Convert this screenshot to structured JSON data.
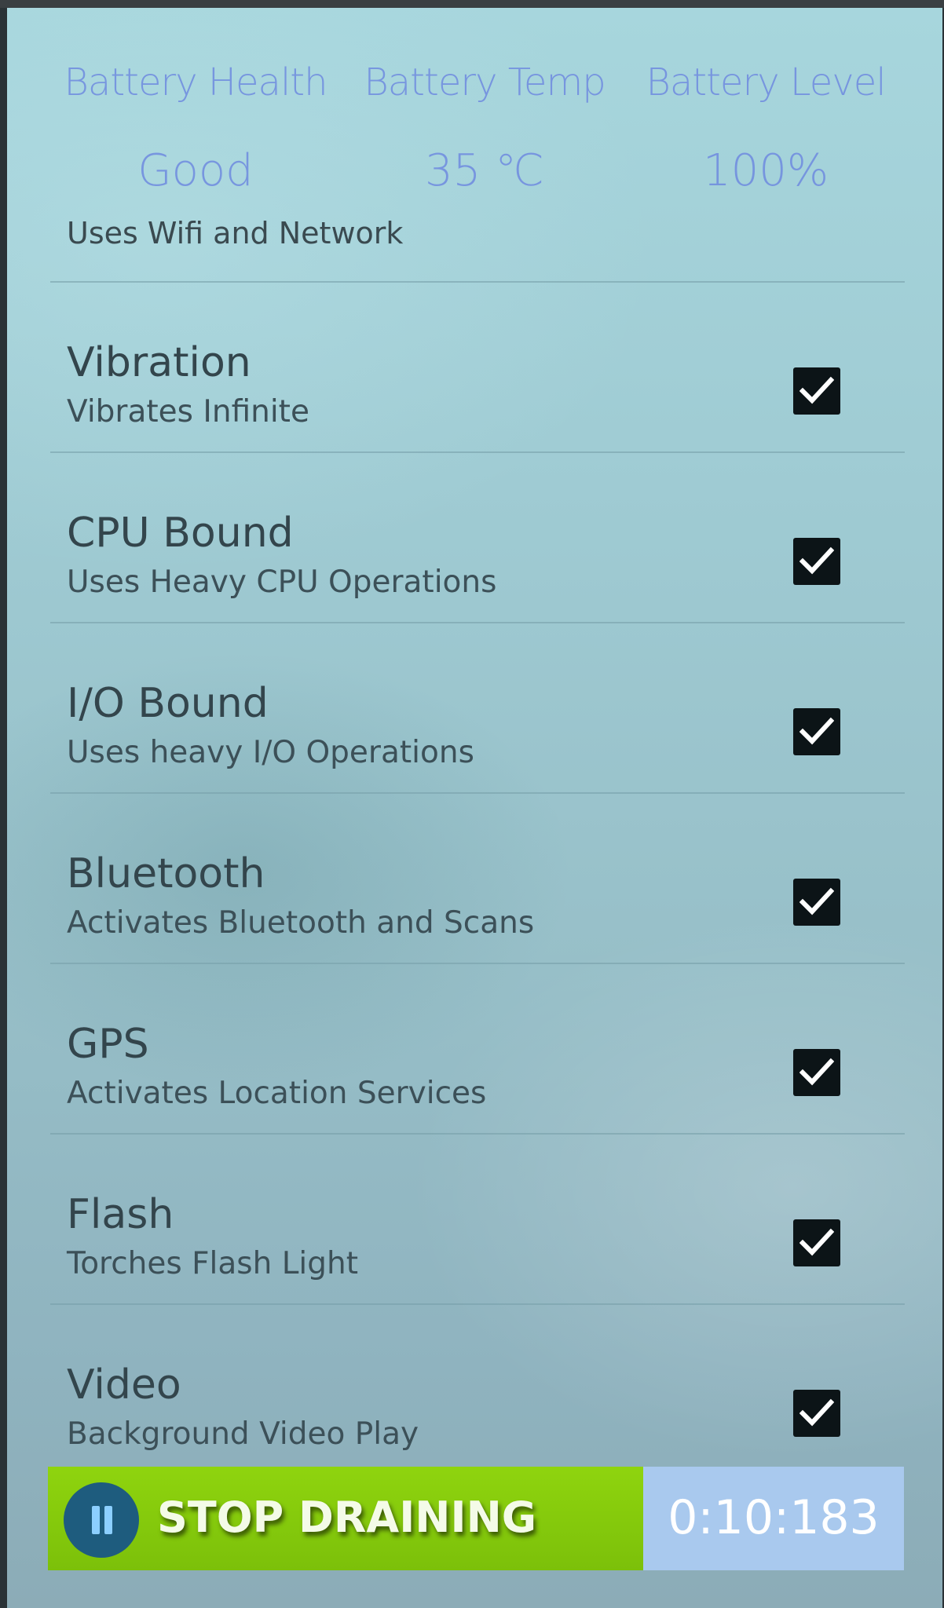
{
  "battery": {
    "health_label": "Battery Health",
    "health_value": "Good",
    "temp_label": "Battery Temp",
    "temp_value": "35 ℃",
    "level_label": "Battery Level",
    "level_value": "100%"
  },
  "partial_item": {
    "subtitle": "Uses Wifi and Network"
  },
  "items": [
    {
      "title": "Vibration",
      "subtitle": "Vibrates Infinite",
      "checked": true
    },
    {
      "title": "CPU Bound",
      "subtitle": "Uses Heavy CPU Operations",
      "checked": true
    },
    {
      "title": "I/O Bound",
      "subtitle": "Uses heavy I/O Operations",
      "checked": true
    },
    {
      "title": "Bluetooth",
      "subtitle": "Activates Bluetooth and Scans",
      "checked": true
    },
    {
      "title": "GPS",
      "subtitle": "Activates Location Services",
      "checked": true
    },
    {
      "title": "Flash",
      "subtitle": "Torches Flash Light",
      "checked": true
    },
    {
      "title": "Video",
      "subtitle": "Background Video Play",
      "checked": true
    }
  ],
  "action": {
    "stop_label": "STOP DRAINING",
    "timer": "0:10:183"
  },
  "colors": {
    "stop_button": "#7cc00a",
    "timer_box": "#a9c9ee",
    "pause_circle": "#1e5c7e",
    "stat_text": "#6f8be0"
  },
  "icons": {
    "pause": "pause-icon",
    "check": "checkmark-icon"
  }
}
